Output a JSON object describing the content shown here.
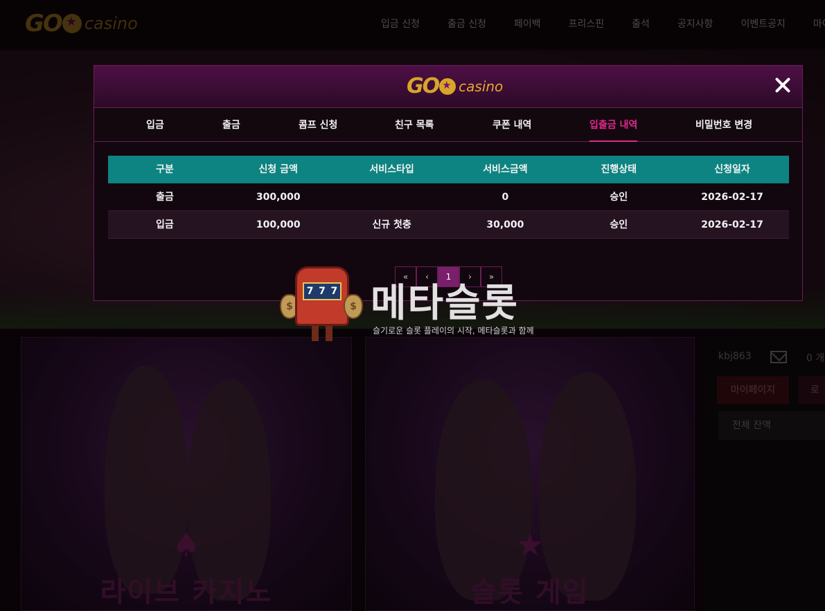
{
  "site": {
    "logo_go": "GO",
    "logo_casino": "casino"
  },
  "nav": {
    "items": [
      "입금 신청",
      "출금 신청",
      "페이백",
      "프리스핀",
      "출석",
      "공지사항",
      "이벤트공지",
      "마이"
    ]
  },
  "panels": {
    "live_title": "라이브 카지노",
    "live_icon": "spade-icon",
    "slot_title": "슬롯 게임",
    "slot_icon": "star-icon"
  },
  "user": {
    "username": "kbj863",
    "message_count": "0 개",
    "mypage_label": "마이페이지",
    "logout_label": "로",
    "balance_label": "전체 잔액"
  },
  "modal": {
    "logo_go": "GO",
    "logo_casino": "casino",
    "tabs": [
      "입금",
      "출금",
      "콤프 신청",
      "친구 목록",
      "쿠폰 내역",
      "입출금 내역",
      "비밀번호 변경"
    ],
    "active_tab": "입출금 내역",
    "table": {
      "headers": [
        "구분",
        "신청 금액",
        "서비스타입",
        "서비스금액",
        "진행상태",
        "신청일자"
      ],
      "rows": [
        [
          "출금",
          "300,000",
          "",
          "0",
          "승인",
          "2026-02-17"
        ],
        [
          "입금",
          "100,000",
          "신규 첫충",
          "30,000",
          "승인",
          "2026-02-17"
        ]
      ]
    },
    "pagination": {
      "first": "«",
      "prev": "‹",
      "current": "1",
      "next": "›",
      "last": "»"
    }
  },
  "watermark": {
    "title": "메타슬롯",
    "subtitle": "슬기로운 슬롯 플레이의 시작, 메타슬롯과 함께",
    "reels": [
      "7",
      "7",
      "7"
    ],
    "bag_symbol": "$"
  },
  "colors": {
    "accent_pink": "#e0288f",
    "table_header": "#0d8481",
    "modal_border": "#6b1d58",
    "gold": "#d7a52a"
  }
}
